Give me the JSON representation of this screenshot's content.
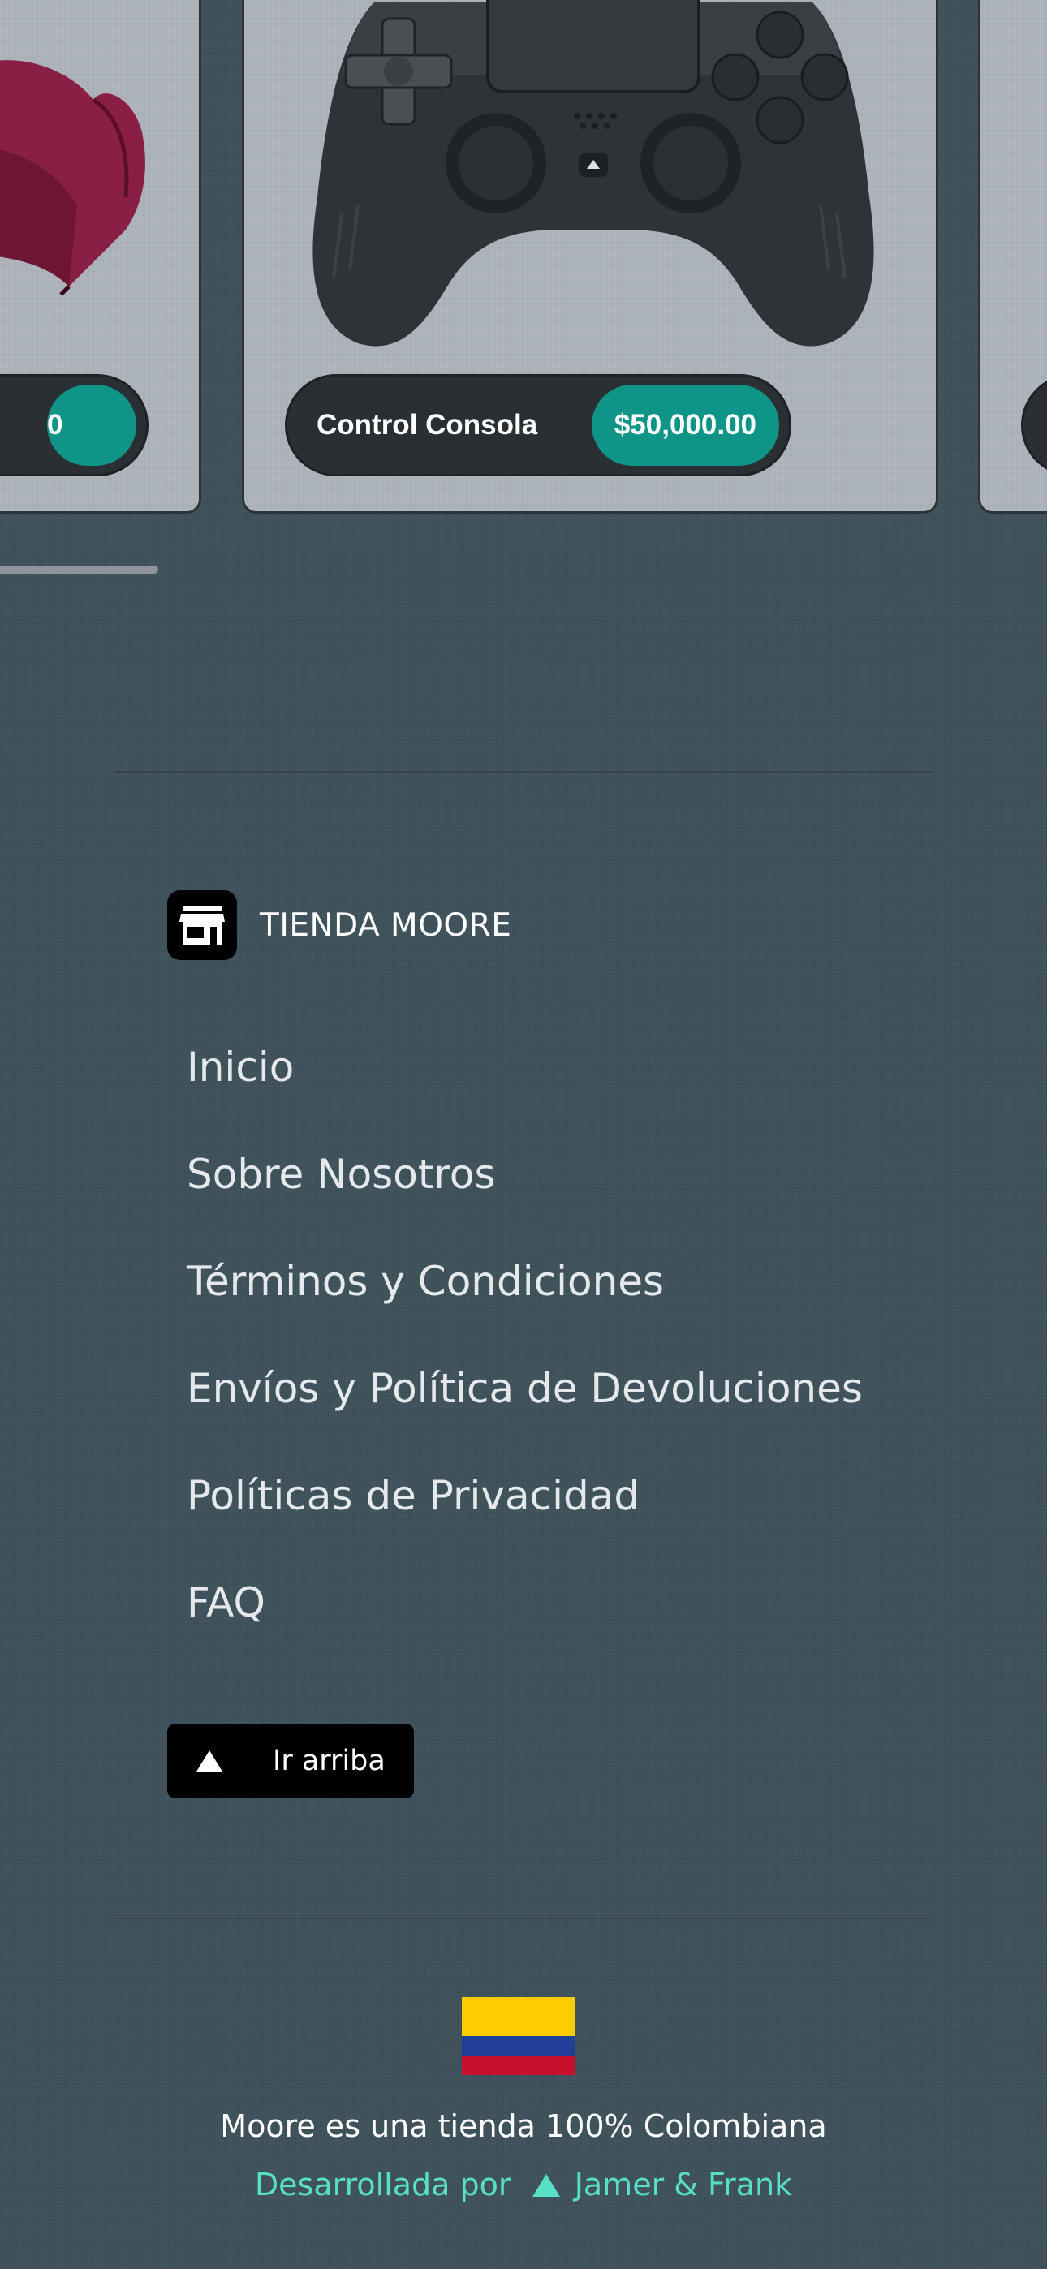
{
  "carousel": {
    "cards": [
      {
        "product_name": "",
        "price": "0"
      },
      {
        "product_name": "Control Consola",
        "price": "$50,000.00"
      },
      {
        "product_name": "",
        "price": ""
      }
    ]
  },
  "footer": {
    "brand": {
      "name": "TIENDA MOORE",
      "icon": "store-icon"
    },
    "nav": [
      {
        "label": "Inicio"
      },
      {
        "label": "Sobre Nosotros"
      },
      {
        "label": "Términos y Condiciones"
      },
      {
        "label": "Envíos y Política de Devoluciones"
      },
      {
        "label": "Políticas de Privacidad"
      },
      {
        "label": "FAQ"
      }
    ],
    "back_to_top": {
      "label": "Ir arriba",
      "icon": "triangle-up-icon"
    },
    "flag": {
      "icon": "colombia-flag-icon",
      "colors": [
        "#fecc00",
        "#1f3f99",
        "#c8102e"
      ]
    },
    "tagline": "Moore es una tienda 100% Colombiana",
    "credit": {
      "prefix": "Desarrollada por",
      "icon": "triangle-up-icon",
      "authors": "Jamer & Frank"
    }
  },
  "colors": {
    "background": "#3f515b",
    "accent": "#0f9587",
    "credit": "#57dfc8",
    "card": "#a8afb6"
  }
}
